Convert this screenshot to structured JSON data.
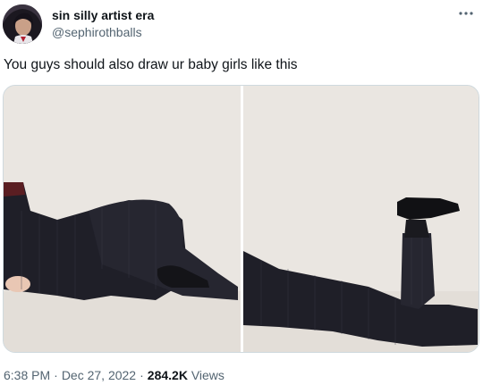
{
  "author": {
    "display_name": "sin silly artist era",
    "handle": "@sephirothballs",
    "avatar_icon": "avatar-image"
  },
  "menu": {
    "icon": "more-horizontal-icon"
  },
  "tweet": {
    "text": "You guys should also draw ur baby girls like this"
  },
  "media": {
    "count": 2,
    "photos": [
      "photo-1",
      "photo-2"
    ],
    "background_color": "#e9e5e0",
    "suit_color": "#1f1f28"
  },
  "footer": {
    "time": "6:38 PM",
    "separator": "·",
    "date": "Dec 27, 2022",
    "views_count": "284.2K",
    "views_label": "Views"
  }
}
